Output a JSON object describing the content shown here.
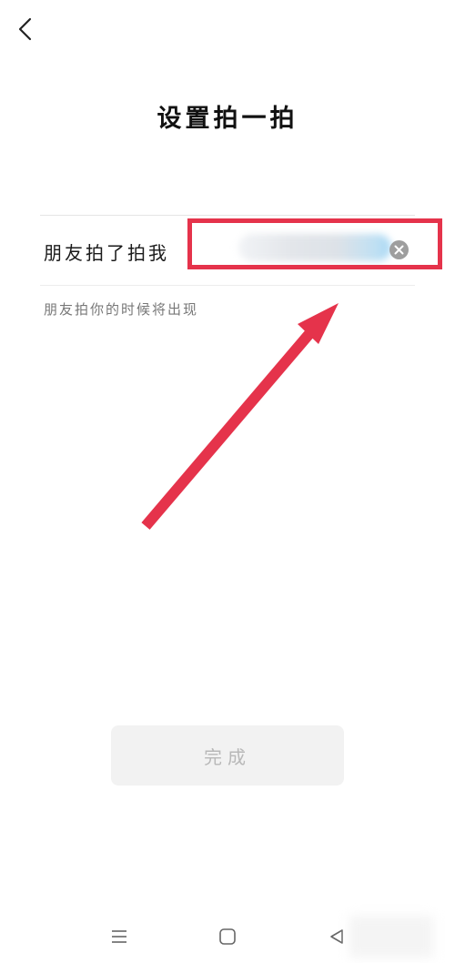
{
  "header": {
    "back_icon": "chevron-left-icon",
    "title": "设置拍一拍"
  },
  "form": {
    "label": "朋友拍了拍我",
    "input_value": "",
    "clear_icon": "clear-circle-icon",
    "hint": "朋友拍你的时候将出现"
  },
  "annotation": {
    "highlight_color": "#e5334b",
    "arrow_color": "#e5334b"
  },
  "footer": {
    "done_label": "完成"
  },
  "navbar": {
    "icons": [
      "menu-icon",
      "home-square-icon",
      "back-triangle-icon"
    ]
  }
}
